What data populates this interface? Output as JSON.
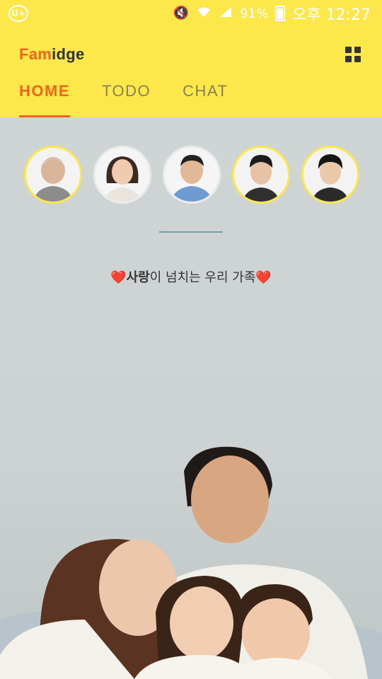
{
  "status_bar": {
    "carrier_logo": "U+",
    "battery_percent": "91%",
    "time": "오후 12:27",
    "icons": [
      "mute-icon",
      "wifi-icon",
      "signal-icon",
      "battery-icon"
    ]
  },
  "app": {
    "brand_part1": "Fam",
    "brand_part2": "idge",
    "menu_icon": "grid-menu-icon"
  },
  "tabs": [
    {
      "label": "HOME",
      "active": true
    },
    {
      "label": "TODO",
      "active": false
    },
    {
      "label": "CHAT",
      "active": false
    }
  ],
  "members": [
    {
      "name": "grandfather",
      "ring": "highlight"
    },
    {
      "name": "mother",
      "ring": "plain"
    },
    {
      "name": "father",
      "ring": "plain"
    },
    {
      "name": "son",
      "ring": "highlight"
    },
    {
      "name": "younger-son",
      "ring": "highlight"
    }
  ],
  "tagline": {
    "heart": "❤️",
    "bold": "사랑",
    "rest": "이 넘치는 우리 가족"
  },
  "colors": {
    "header": "#fce84a",
    "accent": "#f0641e",
    "heart": "#e8262b"
  }
}
